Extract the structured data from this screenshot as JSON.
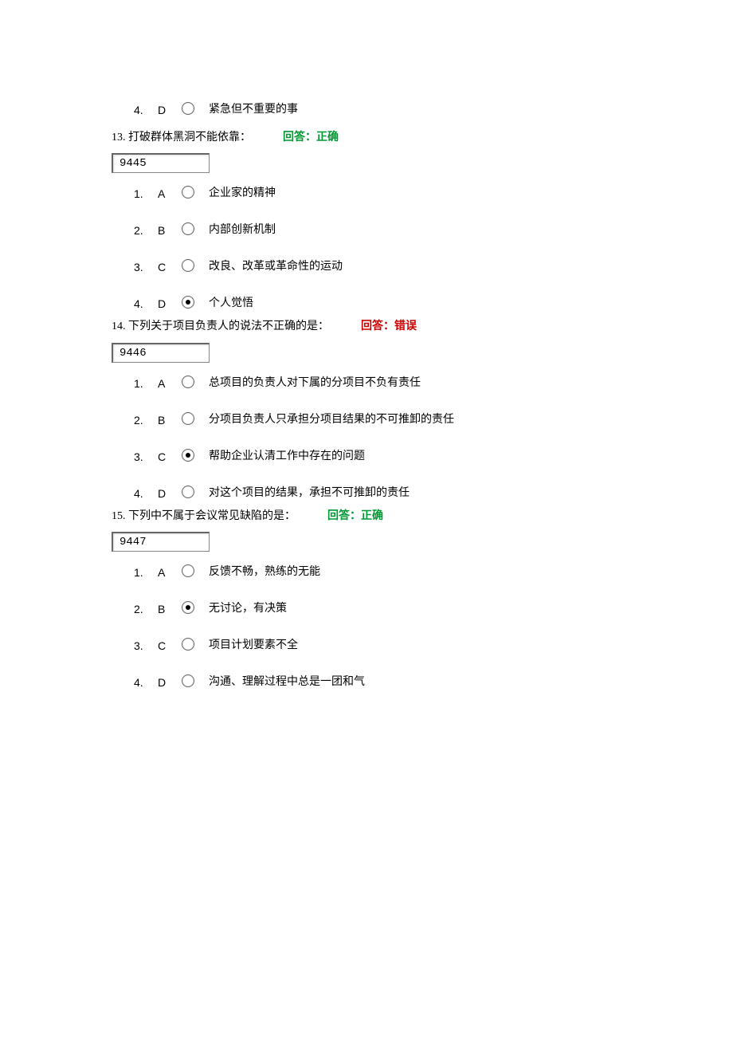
{
  "orphan": {
    "index": "4.",
    "letter": "D",
    "selected": false,
    "text": "紧急但不重要的事"
  },
  "questions": [
    {
      "num": "13.",
      "text": "打破群体黑洞不能依靠：",
      "feedback": "回答：正确",
      "feedback_class": "correct",
      "id": "9445",
      "options": [
        {
          "index": "1.",
          "letter": "A",
          "selected": false,
          "text": "企业家的精神"
        },
        {
          "index": "2.",
          "letter": "B",
          "selected": false,
          "text": "内部创新机制"
        },
        {
          "index": "3.",
          "letter": "C",
          "selected": false,
          "text": "改良、改革或革命性的运动"
        },
        {
          "index": "4.",
          "letter": "D",
          "selected": true,
          "text": "个人觉悟"
        }
      ]
    },
    {
      "num": "14.",
      "text": "下列关于项目负责人的说法不正确的是：",
      "feedback": "回答：错误",
      "feedback_class": "wrong",
      "id": "9446",
      "options": [
        {
          "index": "1.",
          "letter": "A",
          "selected": false,
          "text": "总项目的负责人对下属的分项目不负有责任"
        },
        {
          "index": "2.",
          "letter": "B",
          "selected": false,
          "text": "分项目负责人只承担分项目结果的不可推卸的责任"
        },
        {
          "index": "3.",
          "letter": "C",
          "selected": true,
          "text": "帮助企业认清工作中存在的问题"
        },
        {
          "index": "4.",
          "letter": "D",
          "selected": false,
          "text": "对这个项目的结果，承担不可推卸的责任"
        }
      ]
    },
    {
      "num": "15.",
      "text": "下列中不属于会议常见缺陷的是：",
      "feedback": "回答：正确",
      "feedback_class": "correct",
      "id": "9447",
      "options": [
        {
          "index": "1.",
          "letter": "A",
          "selected": false,
          "text": "反馈不畅，熟练的无能"
        },
        {
          "index": "2.",
          "letter": "B",
          "selected": true,
          "text": "无讨论，有决策"
        },
        {
          "index": "3.",
          "letter": "C",
          "selected": false,
          "text": "项目计划要素不全"
        },
        {
          "index": "4.",
          "letter": "D",
          "selected": false,
          "text": "沟通、理解过程中总是一团和气"
        }
      ]
    }
  ]
}
